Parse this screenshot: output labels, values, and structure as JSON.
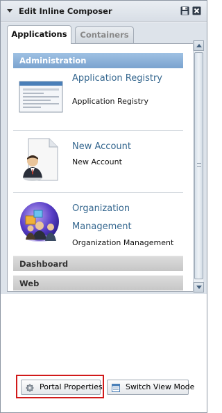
{
  "window": {
    "title": "Edit Inline Composer",
    "icons": {
      "save": "floppy-disk-icon",
      "close": "close-icon",
      "collapse": "collapse-arrow-icon"
    }
  },
  "tabs": [
    {
      "label": "Applications",
      "active": true
    },
    {
      "label": "Containers",
      "active": false
    }
  ],
  "categories": [
    {
      "label": "Administration",
      "expanded": true,
      "apps": [
        {
          "name": "Application Registry",
          "description": "Application Registry",
          "icon": "application-registry-icon"
        },
        {
          "name": "New Account",
          "description": "New Account",
          "icon": "new-account-icon"
        },
        {
          "name_line1": "Organization",
          "name_line2": "Management",
          "description": "Organization Management",
          "icon": "organization-management-icon"
        }
      ]
    },
    {
      "label": "Dashboard",
      "expanded": false
    },
    {
      "label": "Web",
      "expanded": false
    }
  ],
  "footer": {
    "portal_properties": "Portal Properties",
    "switch_view_mode": "Switch View Mode"
  },
  "colors": {
    "accent_header": "#7aa3cf",
    "app_link": "#35678f",
    "highlight": "#d11a1a"
  }
}
